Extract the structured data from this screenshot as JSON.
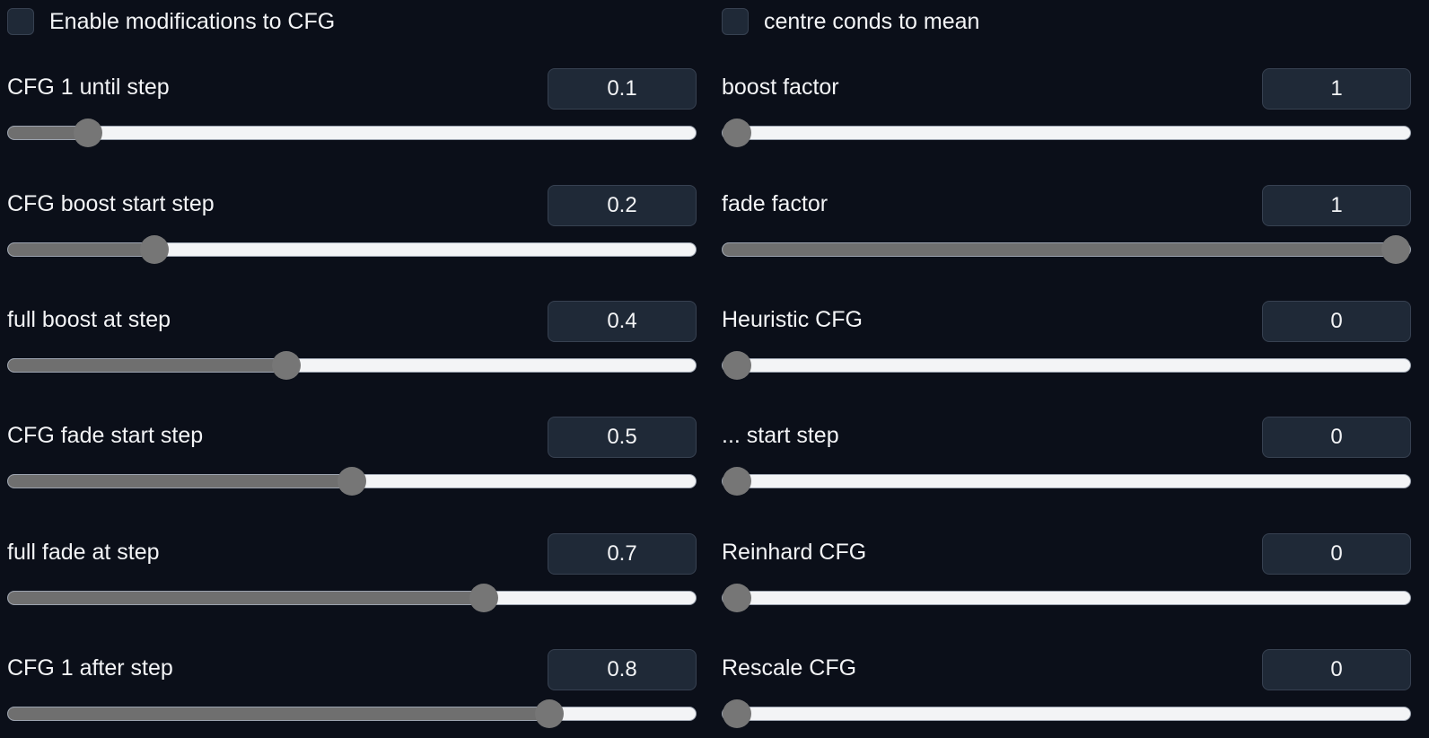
{
  "left": {
    "checkbox": {
      "label": "Enable modifications to CFG",
      "checked": false
    },
    "sliders": [
      {
        "label": "CFG 1 until step",
        "value": "0.1",
        "fraction": 0.1
      },
      {
        "label": "CFG boost start step",
        "value": "0.2",
        "fraction": 0.2
      },
      {
        "label": "full boost at step",
        "value": "0.4",
        "fraction": 0.4
      },
      {
        "label": "CFG fade start step",
        "value": "0.5",
        "fraction": 0.5
      },
      {
        "label": "full fade at step",
        "value": "0.7",
        "fraction": 0.7
      },
      {
        "label": "CFG 1 after step",
        "value": "0.8",
        "fraction": 0.8
      }
    ]
  },
  "right": {
    "checkbox": {
      "label": "centre conds to mean",
      "checked": false
    },
    "sliders": [
      {
        "label": "boost factor",
        "value": "1",
        "fraction": 0.0
      },
      {
        "label": "fade factor",
        "value": "1",
        "fraction": 1.0
      },
      {
        "label": "Heuristic CFG",
        "value": "0",
        "fraction": 0.0
      },
      {
        "label": "... start step",
        "value": "0",
        "fraction": 0.0
      },
      {
        "label": "Reinhard CFG",
        "value": "0",
        "fraction": 0.0
      },
      {
        "label": "Rescale CFG",
        "value": "0",
        "fraction": 0.0
      }
    ]
  },
  "colors": {
    "background": "#0b0f19",
    "input_background": "#1f2937",
    "slider_fill": "#6f6f6f",
    "slider_track": "#f3f4f6",
    "text": "#f3f4f6"
  }
}
